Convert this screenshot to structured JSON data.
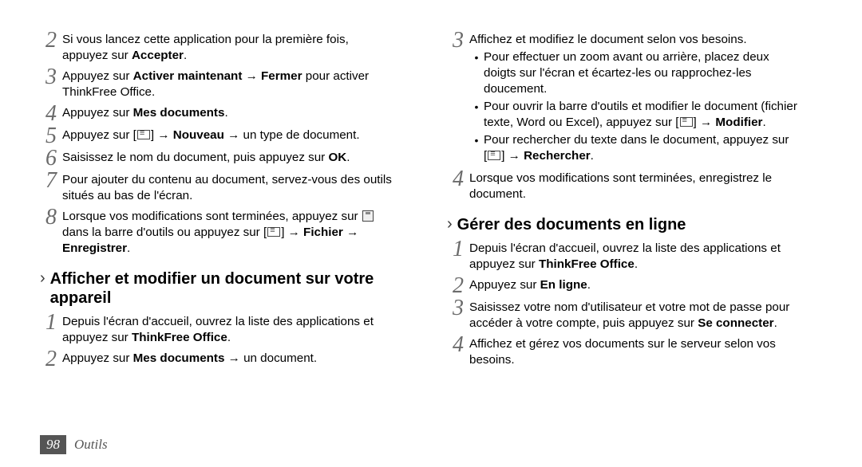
{
  "left": {
    "step2": {
      "n": "2",
      "l1": "Si vous lancez cette application pour la première fois,",
      "l2a": "appuyez sur ",
      "l2b": "Accepter",
      "l2c": "."
    },
    "step3": {
      "n": "3",
      "a": "Appuyez sur ",
      "b": "Activer maintenant",
      "c": " → ",
      "d": "Fermer",
      "e": " pour activer",
      "l2": "ThinkFree Office."
    },
    "step4": {
      "n": "4",
      "a": "Appuyez sur ",
      "b": "Mes documents",
      "c": "."
    },
    "step5": {
      "n": "5",
      "a": "Appuyez sur [",
      "b": "] → ",
      "c": "Nouveau",
      "d": " → un type de document."
    },
    "step6": {
      "n": "6",
      "a": "Saisissez le nom du document, puis appuyez sur ",
      "b": "OK",
      "c": "."
    },
    "step7": {
      "n": "7",
      "l1": "Pour ajouter du contenu au document, servez-vous des outils",
      "l2": "situés au bas de l'écran."
    },
    "step8": {
      "n": "8",
      "a": "Lorsque vos modifications sont terminées, appuyez sur ",
      "l2a": "dans la barre d'outils ou appuyez sur [",
      "l2b": "] → ",
      "l2c": "Fichier",
      "l2d": " → ",
      "l3a": "Enregistrer",
      "l3b": "."
    },
    "section1": {
      "t1": "Afficher et modifier un document sur votre",
      "t2": "appareil"
    },
    "s1step1": {
      "n": "1",
      "l1": "Depuis l'écran d'accueil, ouvrez la liste des applications et",
      "l2a": "appuyez sur ",
      "l2b": "ThinkFree Office",
      "l2c": "."
    },
    "s1step2": {
      "n": "2",
      "a": "Appuyez sur ",
      "b": "Mes documents",
      "c": " → un document."
    }
  },
  "right": {
    "step3": {
      "n": "3",
      "l1": "Affichez et modifiez le document selon vos besoins.",
      "b1": {
        "l1": "Pour effectuer un zoom avant ou arrière, placez deux",
        "l2": "doigts sur l'écran et écartez-les ou rapprochez-les",
        "l3": "doucement."
      },
      "b2": {
        "l1": "Pour ouvrir la barre d'outils et modifier le document (fichier",
        "l2a": "texte, Word ou Excel), appuyez sur [",
        "l2b": "] → ",
        "l2c": "Modifier",
        "l2d": "."
      },
      "b3": {
        "l1": "Pour rechercher du texte dans le document, appuyez sur",
        "l2a": "[",
        "l2b": "] → ",
        "l2c": "Rechercher",
        "l2d": "."
      }
    },
    "step4": {
      "n": "4",
      "l1": "Lorsque vos modifications sont terminées, enregistrez le",
      "l2": "document."
    },
    "section2": "Gérer des documents en ligne",
    "s2step1": {
      "n": "1",
      "l1": "Depuis l'écran d'accueil, ouvrez la liste des applications et",
      "l2a": "appuyez sur ",
      "l2b": "ThinkFree Office",
      "l2c": "."
    },
    "s2step2": {
      "n": "2",
      "a": "Appuyez sur ",
      "b": "En ligne",
      "c": "."
    },
    "s2step3": {
      "n": "3",
      "l1": "Saisissez votre nom d'utilisateur et votre mot de passe pour",
      "l2a": "accéder à votre compte, puis appuyez sur ",
      "l2b": "Se connecter",
      "l2c": "."
    },
    "s2step4": {
      "n": "4",
      "l1": "Affichez et gérez vos documents sur le serveur selon vos",
      "l2": "besoins."
    }
  },
  "footer": {
    "page": "98",
    "section": "Outils"
  }
}
